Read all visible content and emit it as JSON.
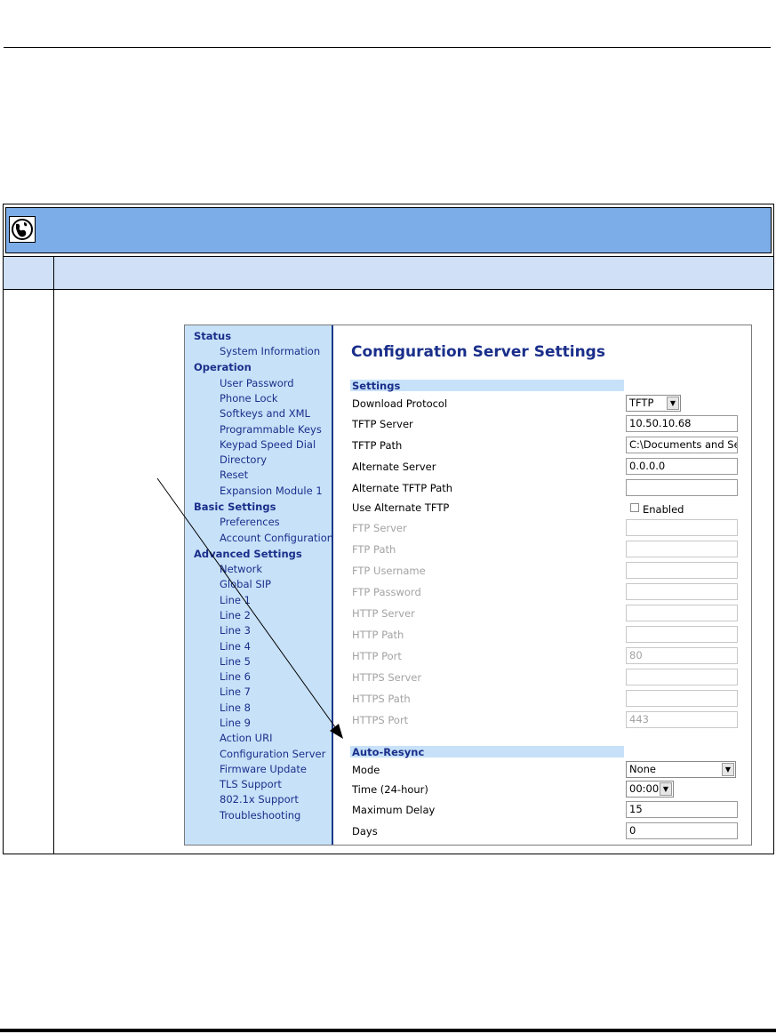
{
  "nav": {
    "status_heading": "Status",
    "status_items": [
      "System Information"
    ],
    "operation_heading": "Operation",
    "operation_items": [
      "User Password",
      "Phone Lock",
      "Softkeys and XML",
      "Programmable Keys",
      "Keypad Speed Dial",
      "Directory",
      "Reset",
      "Expansion Module 1"
    ],
    "basic_heading": "Basic Settings",
    "basic_items": [
      "Preferences",
      "Account Configuration"
    ],
    "advanced_heading": "Advanced Settings",
    "advanced_items": [
      "Network",
      "Global SIP",
      "Line 1",
      "Line 2",
      "Line 3",
      "Line 4",
      "Line 5",
      "Line 6",
      "Line 7",
      "Line 8",
      "Line 9",
      "Action URI",
      "Configuration Server",
      "Firmware Update",
      "TLS Support",
      "802.1x Support",
      "Troubleshooting"
    ]
  },
  "page": {
    "title": "Configuration Server Settings",
    "settings_section": "Settings",
    "autoresync_section": "Auto-Resync"
  },
  "settings": {
    "download_protocol": {
      "label": "Download Protocol",
      "value": "TFTP"
    },
    "tftp_server": {
      "label": "TFTP Server",
      "value": "10.50.10.68"
    },
    "tftp_path": {
      "label": "TFTP Path",
      "value": "C:\\Documents and Sett"
    },
    "alternate_server": {
      "label": "Alternate Server",
      "value": "0.0.0.0"
    },
    "alternate_tftp_path": {
      "label": "Alternate TFTP Path",
      "value": ""
    },
    "use_alternate_tftp": {
      "label": "Use Alternate TFTP",
      "checkbox_label": "Enabled",
      "checked": false
    },
    "ftp_server": {
      "label": "FTP Server",
      "value": ""
    },
    "ftp_path": {
      "label": "FTP Path",
      "value": ""
    },
    "ftp_username": {
      "label": "FTP Username",
      "value": ""
    },
    "ftp_password": {
      "label": "FTP Password",
      "value": ""
    },
    "http_server": {
      "label": "HTTP Server",
      "value": ""
    },
    "http_path": {
      "label": "HTTP Path",
      "value": ""
    },
    "http_port": {
      "label": "HTTP Port",
      "value": "80"
    },
    "https_server": {
      "label": "HTTPS Server",
      "value": ""
    },
    "https_path": {
      "label": "HTTPS Path",
      "value": ""
    },
    "https_port": {
      "label": "HTTPS Port",
      "value": "443"
    }
  },
  "autoresync": {
    "mode": {
      "label": "Mode",
      "value": "None"
    },
    "time": {
      "label": "Time (24-hour)",
      "value": "00:00"
    },
    "max_delay": {
      "label": "Maximum Delay",
      "value": "15"
    },
    "days": {
      "label": "Days",
      "value": "0"
    }
  },
  "colors": {
    "banner": "#7dade8",
    "header_row": "#cfe0f7",
    "nav_background": "#c7e1f9",
    "link_text": "#1a2f8a",
    "disabled_text": "#a3a3a3"
  },
  "icons": {
    "banner_icon": "globe-phone-icon",
    "dropdown_arrow": "chevron-down-icon"
  }
}
